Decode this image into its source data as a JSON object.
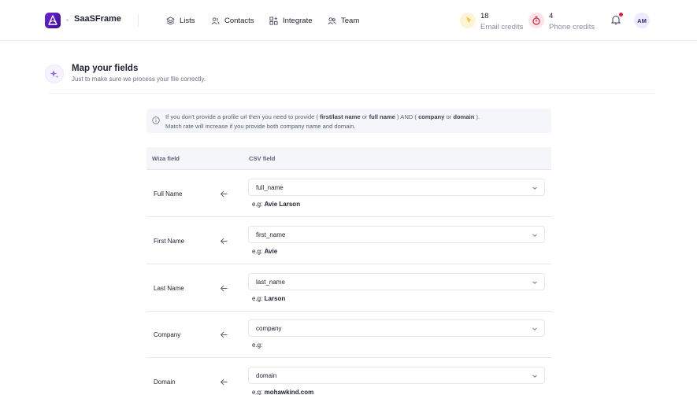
{
  "app": {
    "name": "SaaSFrame"
  },
  "nav": [
    {
      "label": "Lists",
      "icon": "layers-icon"
    },
    {
      "label": "Contacts",
      "icon": "users-icon"
    },
    {
      "label": "Integrate",
      "icon": "grid-plus-icon"
    },
    {
      "label": "Team",
      "icon": "team-icon"
    }
  ],
  "credits": {
    "email": {
      "count": "18",
      "label": "Email credits",
      "color": "#f6c244"
    },
    "phone": {
      "count": "4",
      "label": "Phone credits",
      "color": "#e11d48"
    }
  },
  "user": {
    "initials": "AM"
  },
  "page": {
    "title": "Map your fields",
    "subtitle": "Just to make sure we process your file correctly."
  },
  "info": {
    "t1": "If you don't provide a profile url then you need to provide (",
    "b1": "first/last name",
    "t2": " or ",
    "b2": "full name",
    "t3": ") AND (",
    "b3": "company",
    "t4": " or ",
    "b4": "domain",
    "t5": ").",
    "line2": "Match rate will increase if you provide both company name and domain."
  },
  "table": {
    "col_wiza": "Wiza field",
    "col_csv": "CSV field",
    "example_prefix": "e.g: ",
    "rows": [
      {
        "field": "Full Name",
        "csv": "full_name",
        "example": "Avie Larson"
      },
      {
        "field": "First Name",
        "csv": "first_name",
        "example": "Avie"
      },
      {
        "field": "Last Name",
        "csv": "last_name",
        "example": "Larson"
      },
      {
        "field": "Company",
        "csv": "company",
        "example": ""
      },
      {
        "field": "Domain",
        "csv": "domain",
        "example": "mohawkind.com"
      }
    ]
  }
}
